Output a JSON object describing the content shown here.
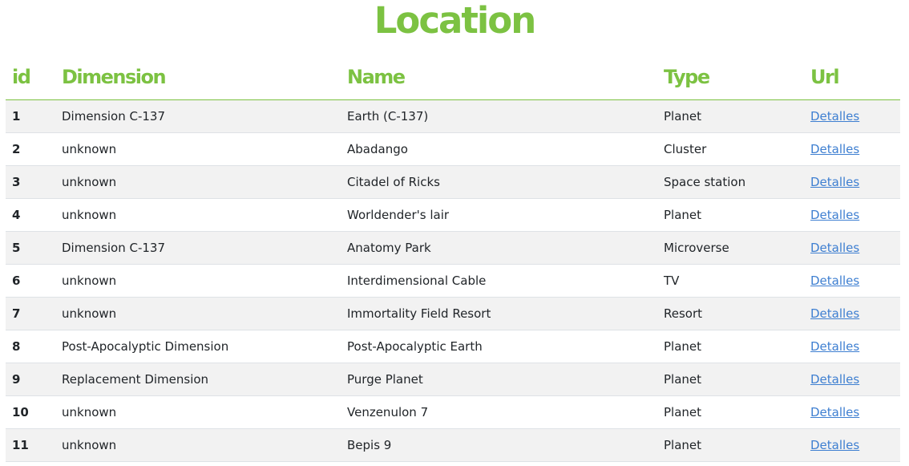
{
  "page": {
    "title": "Location",
    "accent_color": "#7cc242",
    "link_color": "#3e7fd1"
  },
  "table": {
    "headers": {
      "id": "id",
      "dimension": "Dimension",
      "name": "Name",
      "type": "Type",
      "url": "Url"
    },
    "rows": [
      {
        "id": "1",
        "dimension": "Dimension C-137",
        "name": "Earth (C-137)",
        "type": "Planet",
        "url": "Detalles"
      },
      {
        "id": "2",
        "dimension": "unknown",
        "name": "Abadango",
        "type": "Cluster",
        "url": "Detalles"
      },
      {
        "id": "3",
        "dimension": "unknown",
        "name": "Citadel of Ricks",
        "type": "Space station",
        "url": "Detalles"
      },
      {
        "id": "4",
        "dimension": "unknown",
        "name": "Worldender's lair",
        "type": "Planet",
        "url": "Detalles"
      },
      {
        "id": "5",
        "dimension": "Dimension C-137",
        "name": "Anatomy Park",
        "type": "Microverse",
        "url": "Detalles"
      },
      {
        "id": "6",
        "dimension": "unknown",
        "name": "Interdimensional Cable",
        "type": "TV",
        "url": "Detalles"
      },
      {
        "id": "7",
        "dimension": "unknown",
        "name": "Immortality Field Resort",
        "type": "Resort",
        "url": "Detalles"
      },
      {
        "id": "8",
        "dimension": "Post-Apocalyptic Dimension",
        "name": "Post-Apocalyptic Earth",
        "type": "Planet",
        "url": "Detalles"
      },
      {
        "id": "9",
        "dimension": "Replacement Dimension",
        "name": "Purge Planet",
        "type": "Planet",
        "url": "Detalles"
      },
      {
        "id": "10",
        "dimension": "unknown",
        "name": "Venzenulon 7",
        "type": "Planet",
        "url": "Detalles"
      },
      {
        "id": "11",
        "dimension": "unknown",
        "name": "Bepis 9",
        "type": "Planet",
        "url": "Detalles"
      }
    ]
  }
}
